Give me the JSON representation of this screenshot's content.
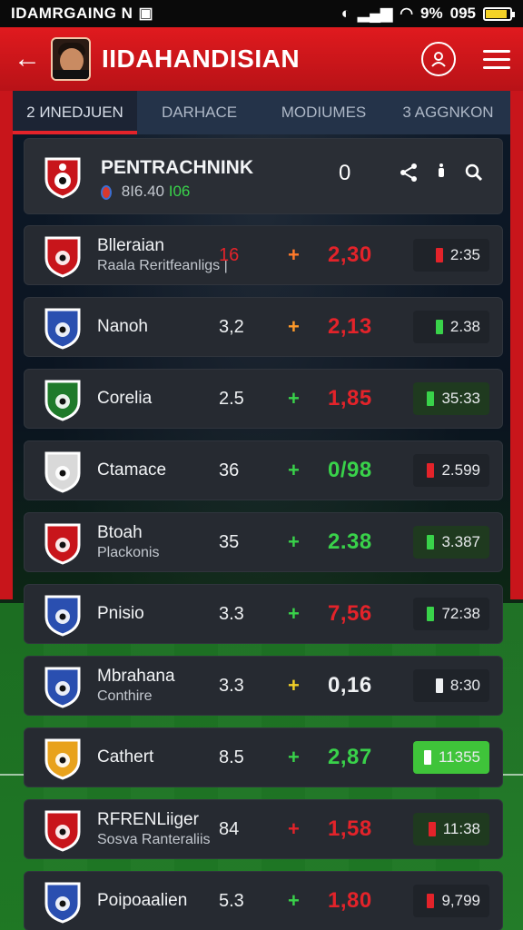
{
  "status_bar": {
    "carrier": "IDAMRGAING N",
    "battery": "9%",
    "time": "095",
    "battery_level": 0.9
  },
  "header": {
    "title": "IIDAHANDISIAN"
  },
  "tabs": [
    {
      "label": "2 ИNEDJUEN",
      "active": true
    },
    {
      "label": "DARHACE",
      "active": false
    },
    {
      "label": "MODIUMES",
      "active": false
    },
    {
      "label": "3 AGGNKON",
      "active": false
    }
  ],
  "featured": {
    "name": "PENTRACHNINK",
    "sub_text": "8I6.40",
    "sub_highlight": "I06",
    "score": "0"
  },
  "matches": [
    {
      "name": "Blleraian",
      "sub": "Raala Reritfeanligs |",
      "rating": "16",
      "rating_color": "#e3232a",
      "change": "+",
      "change_color": "#ff7a2a",
      "odds": "2,30",
      "odds_color": "#e3232a",
      "chip": "2:35",
      "chip_mark_color": "#e3232a",
      "chip_bg": "#1f2329",
      "badge_color": "#c8151b"
    },
    {
      "name": "Nanoh",
      "sub": "",
      "rating": "3,2",
      "rating_color": "#eef0f2",
      "change": "+",
      "change_color": "#ff9a2a",
      "odds": "2,13",
      "odds_color": "#e3232a",
      "chip": "2.38",
      "chip_mark_color": "#39d24a",
      "chip_bg": "#1f2329",
      "badge_color": "#2a4fb0"
    },
    {
      "name": "Corelia",
      "sub": "",
      "rating": "2.5",
      "rating_color": "#eef0f2",
      "change": "+",
      "change_color": "#39d24a",
      "odds": "1,85",
      "odds_color": "#e3232a",
      "chip": "35:33",
      "chip_mark_color": "#39d24a",
      "chip_bg": "#1f3a1f",
      "badge_color": "#1f7a2a"
    },
    {
      "name": "Ctamace",
      "sub": "",
      "rating": "36",
      "rating_color": "#eef0f2",
      "change": "+",
      "change_color": "#39d24a",
      "odds": "0/98",
      "odds_color": "#39d24a",
      "chip": "2.599",
      "chip_mark_color": "#e3232a",
      "chip_bg": "#1f2329",
      "badge_color": "#d9d9d9"
    },
    {
      "name": "Btoah",
      "sub": "Plackonis",
      "rating": "35",
      "rating_color": "#eef0f2",
      "change": "+",
      "change_color": "#39d24a",
      "odds": "2.38",
      "odds_color": "#39d24a",
      "chip": "3.387",
      "chip_mark_color": "#39d24a",
      "chip_bg": "#1f3a1f",
      "badge_color": "#c8151b"
    },
    {
      "name": "Pnisio",
      "sub": "",
      "rating": "3.3",
      "rating_color": "#eef0f2",
      "change": "+",
      "change_color": "#39d24a",
      "odds": "7,56",
      "odds_color": "#e3232a",
      "chip": "72:38",
      "chip_mark_color": "#39d24a",
      "chip_bg": "#1f2329",
      "badge_color": "#2a4fb0"
    },
    {
      "name": "Mbrahana",
      "sub": "Conthire",
      "rating": "3.3",
      "rating_color": "#eef0f2",
      "change": "+",
      "change_color": "#f2d027",
      "odds": "0,16",
      "odds_color": "#eef0f2",
      "chip": "8:30",
      "chip_mark_color": "#eef0f2",
      "chip_bg": "#1f2329",
      "badge_color": "#2a4fb0"
    },
    {
      "name": "Cathert",
      "sub": "",
      "rating": "8.5",
      "rating_color": "#eef0f2",
      "change": "+",
      "change_color": "#39d24a",
      "odds": "2,87",
      "odds_color": "#39d24a",
      "chip": "11355",
      "chip_mark_color": "#ffffff",
      "chip_bg": "#3fc43a",
      "badge_color": "#e8a21c"
    },
    {
      "name": "RFRENLiiger",
      "sub": "Sosva Ranteraliis",
      "rating": "84",
      "rating_color": "#eef0f2",
      "change": "+",
      "change_color": "#e3232a",
      "odds": "1,58",
      "odds_color": "#e3232a",
      "chip": "11:38",
      "chip_mark_color": "#e3232a",
      "chip_bg": "#1f3a1f",
      "badge_color": "#c8151b"
    },
    {
      "name": "Poipoaalien",
      "sub": "",
      "rating": "5.3",
      "rating_color": "#eef0f2",
      "change": "+",
      "change_color": "#39d24a",
      "odds": "1,80",
      "odds_color": "#e3232a",
      "chip": "9,799",
      "chip_mark_color": "#e3232a",
      "chip_bg": "#1f2329",
      "badge_color": "#2a4fb0"
    }
  ]
}
